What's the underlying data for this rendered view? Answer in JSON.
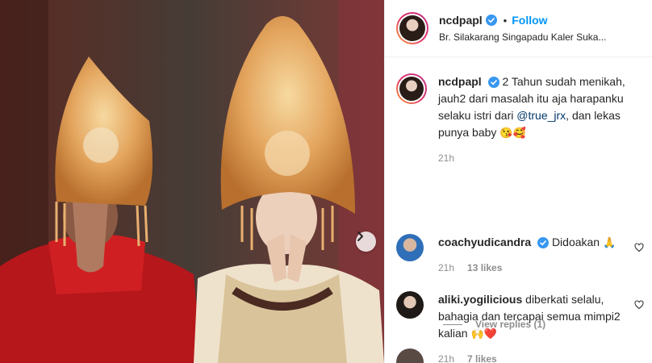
{
  "post": {
    "username": "ncdpapl",
    "follow_label": "Follow",
    "separator": "•",
    "location": "Br. Silakarang Singapadu Kaler Suka..."
  },
  "caption": {
    "username": "ncdpapl",
    "text_before": "2 Tahun sudah menikah, jauh2 dari masalah itu aja harapanku selaku istri dari ",
    "mention": "@true_jrx",
    "text_after": ", dan lekas punya baby ",
    "emoji": "😘🥰",
    "time": "21h"
  },
  "comments": [
    {
      "username": "coachyudicandra",
      "verified": true,
      "text": "Didoakan ",
      "emoji": "🙏",
      "time": "21h",
      "likes": "13 likes"
    },
    {
      "username": "aliki.yogilicious",
      "verified": false,
      "text": "diberkati selalu, bahagia dan tercapai semua mimpi2 kalian ",
      "emoji": "🙌❤️",
      "time": "21h",
      "likes": "7 likes"
    }
  ],
  "view_replies": "View replies (1)",
  "colors": {
    "accent": "#0095f6",
    "verified": "#3897f0",
    "text": "#262626",
    "secondary": "#8e8e8e"
  }
}
